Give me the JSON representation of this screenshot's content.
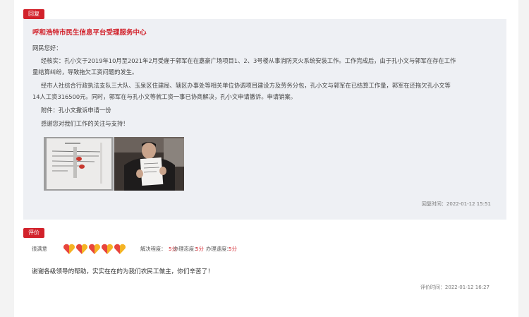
{
  "reply": {
    "tag": "回复",
    "title": "呼和浩特市民生信息平台受理服务中心",
    "greeting": "网民您好：",
    "para1_line1": "经核实：孔小文于2019年10月至2021年2月受雇于郭军在在嘉豪广场项目1、2、3号楼从事消防灭火系统安装工作。工作完成后，由于孔小文与郭军在存在工作",
    "para1_line2": "量结算纠纷，导致拖欠工资问题的发生。",
    "para2_line1": "经市人社综合行政执法支队三大队、玉泉区住建局、辖区办事处等相关单位协调项目建设方及劳务分包，孔小文与郭军在已结算工作量，郭军在还拖欠孔小文等",
    "para2_line2": "14人工资316500元。同时，郭军在与孔小文等就工资一事已协商解决，孔小文申请撤诉。申请销案。",
    "attachment": "附件：孔小文撤诉申请一份",
    "thanks": "感谢您对我们工作的关注与支持！",
    "photos": [
      {
        "icon": "withdrawal-letter-photo"
      },
      {
        "icon": "petitioner-holding-letter-photo"
      }
    ],
    "time": "回复时间：2022-01-12 15:51"
  },
  "evaluation": {
    "tag": "评价",
    "satisfaction_label": "很满意",
    "hearts": 5,
    "colors": {
      "heart_left": "#e8453c",
      "heart_right": "#f5b324"
    },
    "items": [
      {
        "label": "解决程度：",
        "score": "5分"
      },
      {
        "label": "办理态度：",
        "score": "5分"
      },
      {
        "label": "办理速度：",
        "score": "5分"
      }
    ],
    "text": "谢谢各级领导的帮助，实实在在的为我们农民工做主，你们辛苦了！",
    "time": "评价时间：2022-01-12 16:27"
  },
  "colors": {
    "accent": "#d2222b",
    "reply_bg": "#eef0f4"
  }
}
